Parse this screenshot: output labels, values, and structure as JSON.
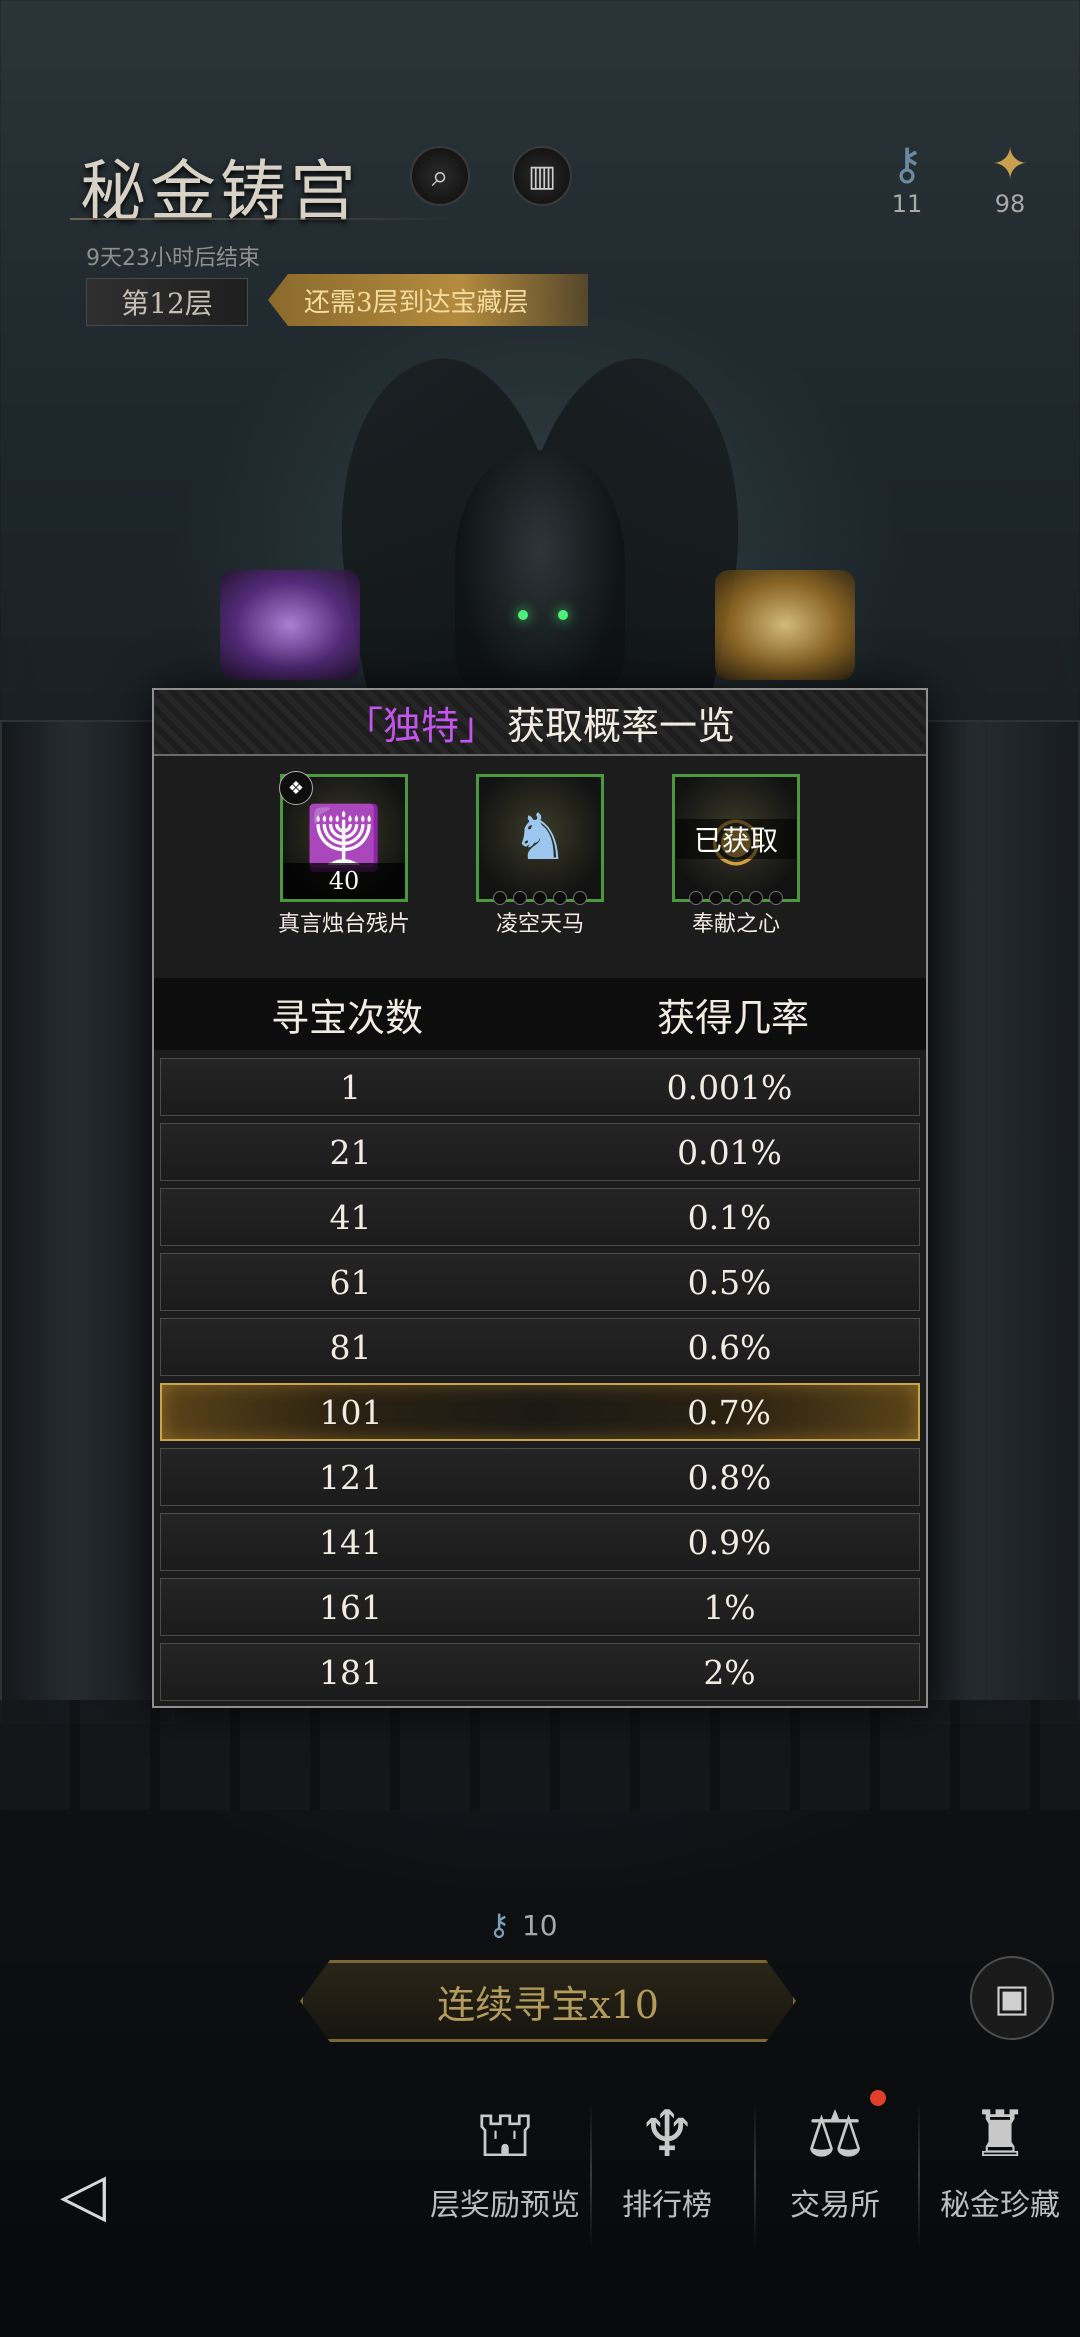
{
  "header": {
    "title": "秘金铸宫",
    "countdown": "9天23小时后结束",
    "floor": "第12层",
    "goal": "还需3层到达宝藏层",
    "currency_1": "11",
    "currency_2": "98"
  },
  "modal": {
    "title_open": "「",
    "title_rarity": "独特",
    "title_close": "」",
    "title_rest": "获取概率一览",
    "rewards": [
      {
        "name": "真言烛台残片",
        "qty": "40",
        "icon": "candelabra-icon",
        "status": ""
      },
      {
        "name": "凌空天马",
        "qty": "",
        "icon": "pegasus-icon",
        "status": ""
      },
      {
        "name": "奉献之心",
        "qty": "",
        "icon": "heart-amulet-icon",
        "status": "已获取"
      }
    ],
    "col_count": "寻宝次数",
    "col_rate": "获得几率",
    "rows": [
      {
        "count": "1",
        "rate": "0.001%"
      },
      {
        "count": "21",
        "rate": "0.01%"
      },
      {
        "count": "41",
        "rate": "0.1%"
      },
      {
        "count": "61",
        "rate": "0.5%"
      },
      {
        "count": "81",
        "rate": "0.6%"
      },
      {
        "count": "101",
        "rate": "0.7%",
        "current": true
      },
      {
        "count": "121",
        "rate": "0.8%"
      },
      {
        "count": "141",
        "rate": "0.9%"
      },
      {
        "count": "161",
        "rate": "1%"
      },
      {
        "count": "181",
        "rate": "2%"
      }
    ]
  },
  "bottom": {
    "key_count": "10",
    "continue_label": "连续寻宝x10",
    "nav": [
      {
        "label": "层奖励预览",
        "icon": "chest-icon"
      },
      {
        "label": "排行榜",
        "icon": "trophy-icon"
      },
      {
        "label": "交易所",
        "icon": "exchange-icon"
      },
      {
        "label": "秘金珍藏",
        "icon": "statue-icon"
      }
    ]
  },
  "colors": {
    "rarity_purple": "#c454ee",
    "highlight_gold": "#c9a44a",
    "item_frame_green": "#4a9a3c"
  }
}
